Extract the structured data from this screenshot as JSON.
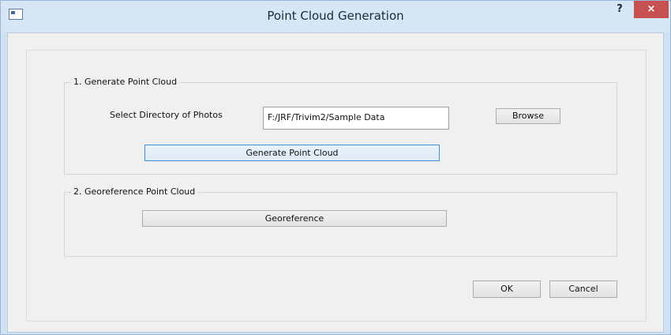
{
  "window": {
    "title": "Point Cloud Generation",
    "help_label": "?",
    "close_label": "×"
  },
  "group1": {
    "title": "1. Generate Point Cloud",
    "dir_label": "Select Directory of Photos",
    "dir_value": "F:/JRF/Trivim2/Sample Data",
    "browse_label": "Browse",
    "generate_label": "Generate Point Cloud"
  },
  "group2": {
    "title": "2. Georeference Point Cloud",
    "georeference_label": "Georeference"
  },
  "footer": {
    "ok_label": "OK",
    "cancel_label": "Cancel"
  }
}
